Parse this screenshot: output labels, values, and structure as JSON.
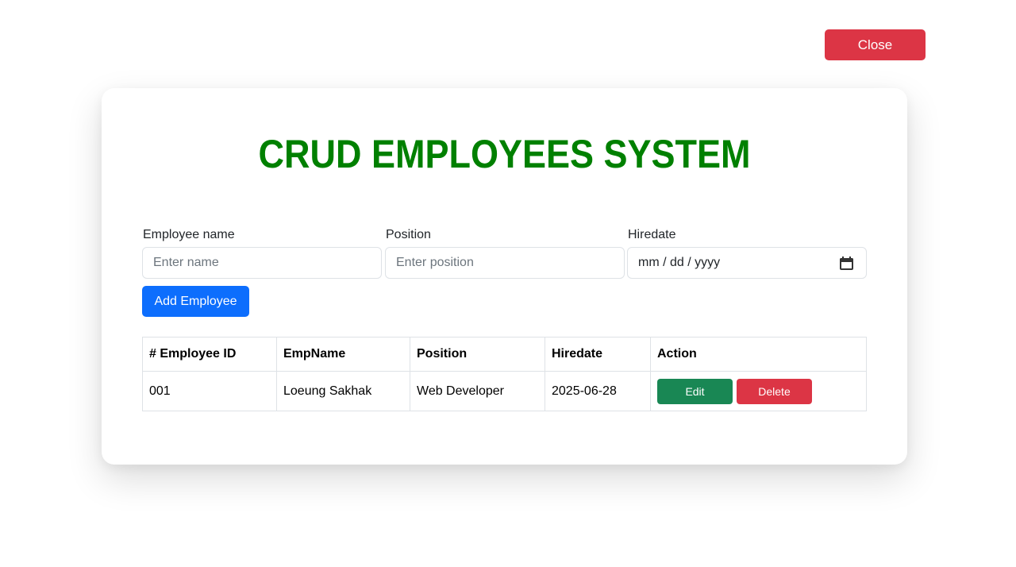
{
  "close_label": "Close",
  "title": "CRUD EMPLOYEES SYSTEM",
  "form": {
    "name_label": "Employee name",
    "name_placeholder": "Enter name",
    "position_label": "Position",
    "position_placeholder": "Enter position",
    "hiredate_label": "Hiredate",
    "hiredate_value": "mm / dd / yyyy",
    "add_label": "Add Employee"
  },
  "table": {
    "headers": [
      "# Employee ID",
      "EmpName",
      "Position",
      "Hiredate",
      "Action"
    ],
    "rows": [
      {
        "id": "001",
        "name": "Loeung Sakhak",
        "position": "Web Developer",
        "hiredate": "2025-06-28",
        "edit_label": "Edit",
        "delete_label": "Delete"
      }
    ]
  },
  "colors": {
    "title": "#008000",
    "primary": "#0d6efd",
    "danger": "#dc3545",
    "success": "#198754"
  },
  "icons": {
    "hiredate": "calendar-icon"
  }
}
